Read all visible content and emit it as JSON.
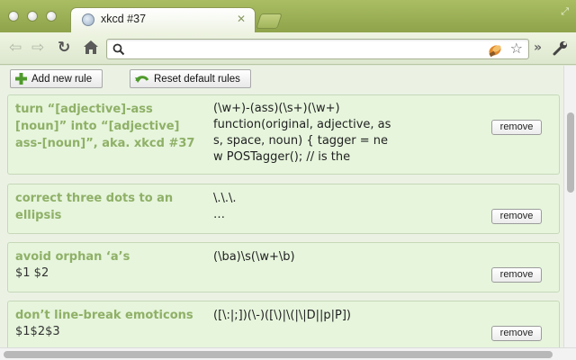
{
  "window": {
    "tab_title": "xkcd #37"
  },
  "toolbar": {
    "address_value": "",
    "address_placeholder": ""
  },
  "actions": {
    "add_rule": "Add new rule",
    "reset_rules": "Reset default rules"
  },
  "rules": [
    {
      "title": "turn “[adjective]-ass [noun]” into “[adjective] ass-[noun]”, aka. xkcd #37",
      "replacement": "",
      "pattern": "(\\w+)-(ass)(\\s+)(\\w+)\nfunction(original, adjective, ass, space, noun) { tagger = new POSTagger(); // is the",
      "remove_label": "remove"
    },
    {
      "title": "correct three dots to an ellipsis",
      "replacement": "",
      "pattern": "\\.\\.\\.\n…",
      "remove_label": "remove"
    },
    {
      "title": "avoid orphan ‘a’s",
      "replacement": "$1 $2",
      "pattern": "(\\ba)\\s(\\w+\\b)",
      "remove_label": "remove"
    },
    {
      "title": "don’t line-break emoticons",
      "replacement": "$1$2$3",
      "pattern": "([\\:|;])(\\-)([\\)|\\(|\\|D||p|P])",
      "remove_label": "remove"
    }
  ],
  "colors": {
    "chrome_green": "#9db055",
    "rule_title": "#8fb067",
    "rule_bg": "#e6f5dc"
  }
}
